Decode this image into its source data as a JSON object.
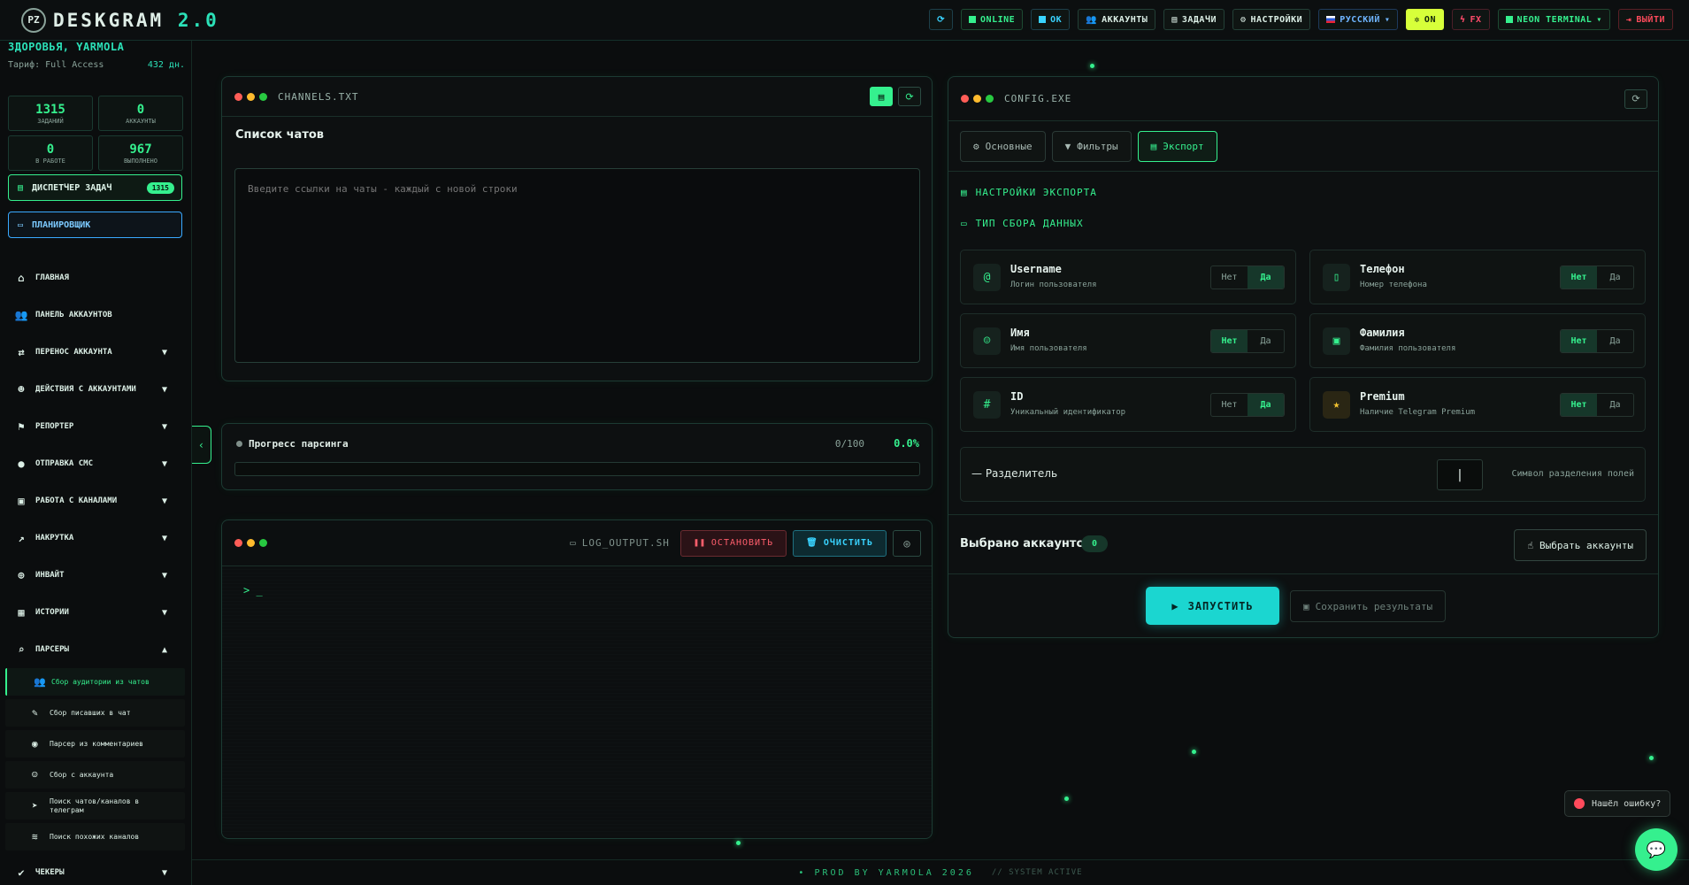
{
  "app": {
    "logo_mark": "PZ",
    "name": "DESKGRAM",
    "version": "2.0"
  },
  "topbar": {
    "buttons": [
      {
        "name": "refresh",
        "label": "⟳"
      },
      {
        "name": "online",
        "label": "ONLINE"
      },
      {
        "name": "ok",
        "label": "OK"
      },
      {
        "name": "accounts",
        "label": "АККАУНТЫ"
      },
      {
        "name": "tasks",
        "label": "ЗАДАЧИ"
      },
      {
        "name": "settings",
        "label": "НАСТРОЙКИ"
      },
      {
        "name": "language",
        "label": "РУССКИЙ"
      },
      {
        "name": "power",
        "label": "ON"
      },
      {
        "name": "fx",
        "label": "FX"
      },
      {
        "name": "theme",
        "label": "NEON TERMINAL"
      },
      {
        "name": "logout",
        "label": "ВЫЙТИ"
      }
    ]
  },
  "sidebar": {
    "user_greeting": "ЗДОРОВЬЯ, YARMOLA",
    "plan_label": "Тариф: Full Access",
    "plan_days": "432 дн.",
    "stats": [
      {
        "value": "1315",
        "label": "ЗАДАНИЙ"
      },
      {
        "value": "0",
        "label": "АККАУНТЫ"
      },
      {
        "value": "0",
        "label": "В РАБОТЕ"
      },
      {
        "value": "967",
        "label": "ВЫПОЛНЕНО"
      }
    ],
    "dispatcher_label": "ДИСПЕТЧЕР ЗАДАЧ",
    "dispatcher_badge": "1315",
    "planner_label": "ПЛАНИРОВЩИК",
    "nav": [
      {
        "label": "ГЛАВНАЯ"
      },
      {
        "label": "ПАНЕЛЬ АККАУНТОВ"
      },
      {
        "label": "ПЕРЕНОС АККАУНТА"
      },
      {
        "label": "ДЕЙСТВИЯ С АККАУНТАМИ"
      },
      {
        "label": "РЕПОРТЕР"
      },
      {
        "label": "ОТПРАВКА СМС"
      },
      {
        "label": "РАБОТА С КАНАЛАМИ"
      },
      {
        "label": "НАКРУТКА"
      },
      {
        "label": "ИНВАЙТ"
      },
      {
        "label": "ИСТОРИИ"
      },
      {
        "label": "ПАРСЕРЫ"
      }
    ],
    "parsers_sub": [
      {
        "label": "Сбор аудитории из чатов"
      },
      {
        "label": "Сбор писавших в чат"
      },
      {
        "label": "Парсер из комментариев"
      },
      {
        "label": "Сбор с аккаунта"
      },
      {
        "label": "Поиск чатов/каналов в телеграм"
      },
      {
        "label": "Поиск похожих каналов"
      }
    ],
    "checkers_label": "ЧЕКЕРЫ"
  },
  "channels": {
    "window_title": "CHANNELS.TXT",
    "heading": "Список чатов",
    "placeholder": "Введите ссылки на чаты - каждый с новой строки"
  },
  "progress": {
    "label": "Прогресс парсинга",
    "count": "0/100",
    "percent_text": "0.0%",
    "percent": 0
  },
  "log": {
    "file_name": "LOG_OUTPUT.SH",
    "stop_label": "ОСТАНОВИТЬ",
    "clear_label": "ОЧИСТИТЬ",
    "prompt": "> _"
  },
  "config": {
    "window_title": "CONFIG.EXE",
    "tabs": [
      {
        "label": "Основные"
      },
      {
        "label": "Фильтры"
      },
      {
        "label": "Экспорт"
      }
    ],
    "export_heading": "НАСТРОЙКИ ЭКСПОРТА",
    "type_heading": "ТИП СБОРА ДАННЫХ",
    "toggle_no": "Нет",
    "toggle_yes": "Да",
    "fields": [
      {
        "name": "Username",
        "desc": "Логин пользователя",
        "icon": "@",
        "value": "yes"
      },
      {
        "name": "Телефон",
        "desc": "Номер телефона",
        "icon": "▯",
        "value": "no"
      },
      {
        "name": "Имя",
        "desc": "Имя пользователя",
        "icon": "☺",
        "value": "no"
      },
      {
        "name": "Фамилия",
        "desc": "Фамилия пользователя",
        "icon": "▣",
        "value": "no"
      },
      {
        "name": "ID",
        "desc": "Уникальный идентификатор",
        "icon": "#",
        "value": "yes"
      },
      {
        "name": "Premium",
        "desc": "Наличие Telegram Premium",
        "icon": "★",
        "value": "no"
      }
    ],
    "separator_label": "— Разделитель",
    "separator_value": "|",
    "separator_hint": "Символ разделения полей",
    "selected_label": "Выбрано аккаунтов:",
    "selected_count": "0",
    "choose_label": "Выбрать аккаунты",
    "run_label": "ЗАПУСТИТЬ",
    "save_label": "Сохранить результаты"
  },
  "footer": {
    "credit": "• PROD BY YARMOLA 2026",
    "status": "// SYSTEM ACTIVE"
  },
  "misc": {
    "bug_label": "Нашёл ошибку?"
  },
  "colors": {
    "accent": "#35f08e",
    "cyan": "#1bd6d0",
    "danger": "#ff5e6c",
    "background": "#0b0d0e"
  }
}
